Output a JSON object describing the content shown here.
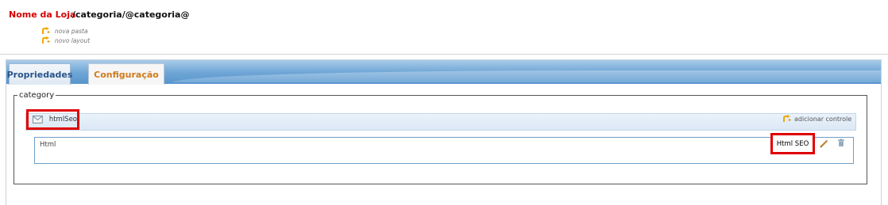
{
  "header": {
    "store_name": "Nome da Loja",
    "path": "/categoria/@categoria@",
    "links": [
      {
        "label": "nova pasta",
        "icon": "add-arrow-icon"
      },
      {
        "label": "novo layout",
        "icon": "add-arrow-icon"
      }
    ]
  },
  "tabs": [
    {
      "label": "Propriedades",
      "active": false
    },
    {
      "label": "Configuração",
      "active": true
    }
  ],
  "category": {
    "legend": "category",
    "control_name": "htmlSeo",
    "control_icon": "mail-icon",
    "add_control_label": "adicionar controle",
    "row": {
      "type_label": "Html",
      "name_label": "Html SEO",
      "actions": [
        "edit-icon",
        "delete-icon"
      ]
    }
  },
  "colors": {
    "store_name": "#d40000",
    "active_tab_text": "#d07a1c",
    "tab_text": "#27548a",
    "highlight_box": "#e00000",
    "tab_bar": "#6fa6d6"
  }
}
